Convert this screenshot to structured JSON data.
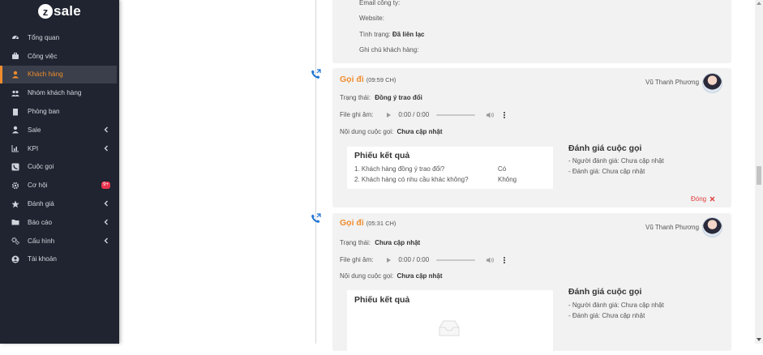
{
  "brand": {
    "logo_letter": "z",
    "logo_text": "sale"
  },
  "sidebar": {
    "items": [
      {
        "label": "Tổng quan",
        "icon": "dashboard-icon"
      },
      {
        "label": "Công việc",
        "icon": "briefcase-icon"
      },
      {
        "label": "Khách hàng",
        "icon": "user-icon",
        "active": true
      },
      {
        "label": "Nhóm khách hàng",
        "icon": "users-icon"
      },
      {
        "label": "Phòng ban",
        "icon": "building-icon"
      },
      {
        "label": "Sale",
        "icon": "user-tie-icon",
        "has_submenu": true
      },
      {
        "label": "KPI",
        "icon": "chart-icon",
        "has_submenu": true
      },
      {
        "label": "Cuộc gọi",
        "icon": "phone-square-icon"
      },
      {
        "label": "Cơ hội",
        "icon": "gear-icon",
        "badge": "9+"
      },
      {
        "label": "Đánh giá",
        "icon": "star-icon",
        "has_submenu": true
      },
      {
        "label": "Báo cáo",
        "icon": "folder-icon",
        "has_submenu": true
      },
      {
        "label": "Cấu hình",
        "icon": "cogs-icon",
        "has_submenu": true
      },
      {
        "label": "Tài khoản",
        "icon": "account-icon"
      }
    ]
  },
  "top_card": {
    "email_label": "Email công ty:",
    "website_label": "Website:",
    "status_label": "Tình trạng:",
    "status_value": "Đã liên lạc",
    "note_label": "Ghi chú khách hàng:"
  },
  "calls": [
    {
      "title": "Gọi đi",
      "time": "(09:59 CH)",
      "agent": "Vũ Thanh Phương",
      "status_label": "Trạng thái:",
      "status_value": "Đồng ý trao đổi",
      "record_label": "File ghi âm:",
      "player_time": "0:00 / 0:00",
      "content_label": "Nội dung cuộc gọi:",
      "content_value": "Chưa cập nhật",
      "result_title": "Phiếu kết quả",
      "results": [
        {
          "q": "1. Khách hàng đồng ý trao đổi?",
          "a": "Có"
        },
        {
          "q": "2. Khách hàng có nhu cầu khác không?",
          "a": "Không"
        }
      ],
      "eval_title": "Đánh giá cuộc gọi",
      "evaluator": "- Người đánh giá: Chưa cập nhật",
      "rating": "- Đánh giá: Chưa cập nhật",
      "close_label": "Đóng"
    },
    {
      "title": "Gọi đi",
      "time": "(05:31 CH)",
      "agent": "Vũ Thanh Phương",
      "status_label": "Trạng thái:",
      "status_value": "Chưa cập nhật",
      "record_label": "File ghi âm:",
      "player_time": "0:00 / 0:00",
      "content_label": "Nội dung cuộc gọi:",
      "content_value": "Chưa cập nhật",
      "result_title": "Phiếu kết quả",
      "eval_title": "Đánh giá cuộc gọi",
      "evaluator": "- Người đánh giá: Chưa cập nhật",
      "rating": "- Đánh giá: Chưa cập nhật"
    }
  ],
  "colors": {
    "accent": "#f08c2d",
    "sidebar_bg": "#1f2430",
    "badge": "#e8344e",
    "phone": "#1e73d6",
    "close": "#e03d3d"
  }
}
